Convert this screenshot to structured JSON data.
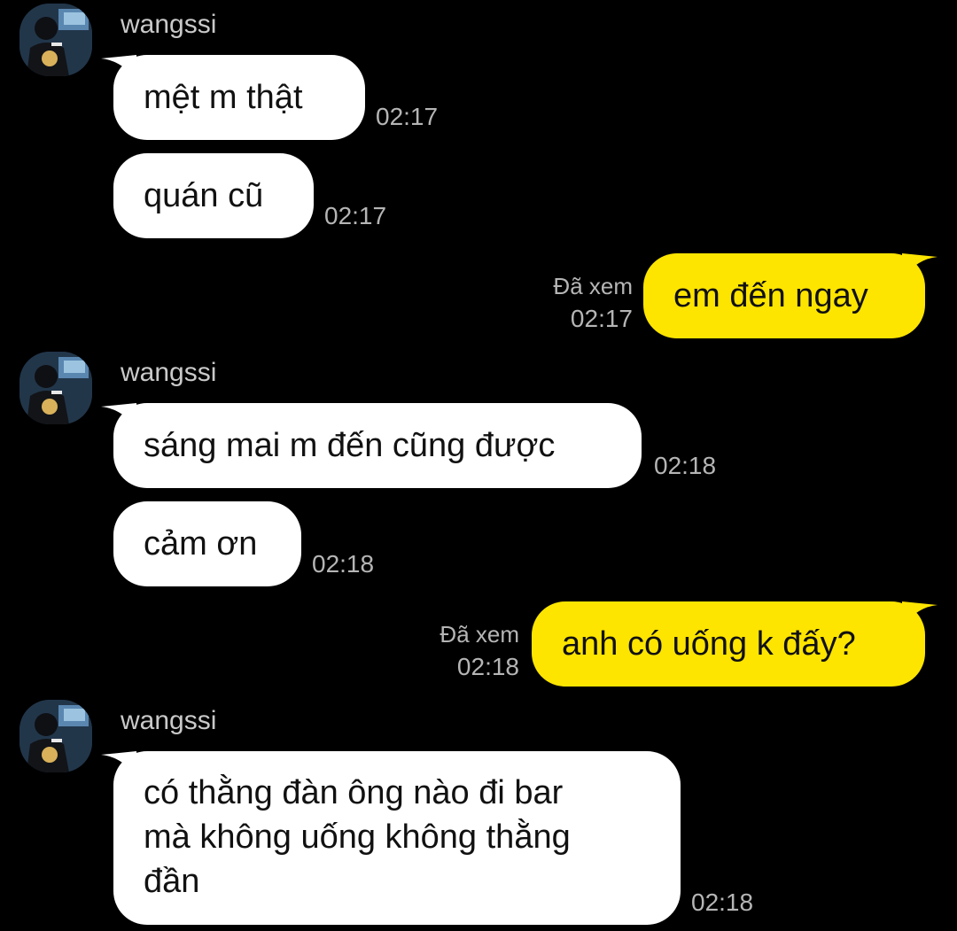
{
  "colors": {
    "background": "#000000",
    "incoming_bubble": "#ffffff",
    "outgoing_bubble": "#fee500",
    "meta_text": "#b5b5b5"
  },
  "icons": {
    "avatar": "avatar-photo-icon"
  },
  "messages": [
    {
      "sender": "wangssi",
      "text": "mệt m thật",
      "time": "02:17"
    },
    {
      "text": "quán cũ",
      "time": "02:17"
    },
    {
      "text": "em đến ngay",
      "read": "Đã xem",
      "time": "02:17"
    },
    {
      "sender": "wangssi",
      "text": "sáng mai m đến cũng được",
      "time": "02:18"
    },
    {
      "text": "cảm ơn",
      "time": "02:18"
    },
    {
      "text": "anh có uống k đấy?",
      "read": "Đã xem",
      "time": "02:18"
    },
    {
      "sender": "wangssi",
      "lines": [
        "có thằng đàn ông nào đi bar",
        "mà không uống không thằng",
        "đần"
      ],
      "time": "02:18"
    }
  ]
}
